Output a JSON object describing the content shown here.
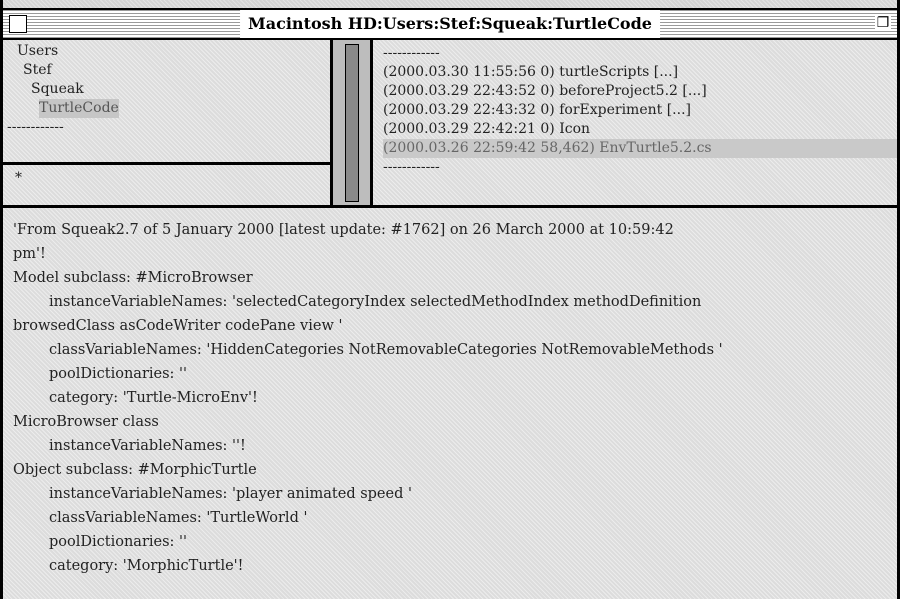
{
  "window": {
    "title": "Macintosh HD:Users:Stef:Squeak:TurtleCode"
  },
  "directory_list": {
    "items": [
      {
        "label": "Users"
      },
      {
        "label": "Stef"
      },
      {
        "label": "Squeak"
      },
      {
        "label": "TurtleCode",
        "selected": true
      },
      {
        "label": "------------"
      }
    ]
  },
  "pattern": {
    "value": "*"
  },
  "file_list": {
    "items": [
      {
        "label": "------------"
      },
      {
        "label": "(2000.03.30 11:55:56 0) turtleScripts [...]"
      },
      {
        "label": "(2000.03.29 22:43:52 0) beforeProject5.2 [...]"
      },
      {
        "label": "(2000.03.29 22:43:32 0) forExperiment [...]"
      },
      {
        "label": "(2000.03.29 22:42:21 0) Icon"
      },
      {
        "label": "(2000.03.26 22:59:42 58,462) EnvTurtle5.2.cs",
        "selected": true
      },
      {
        "label": "------------"
      }
    ]
  },
  "code": {
    "lines": [
      "'From Squeak2.7 of 5 January 2000 [latest update: #1762] on 26 March 2000 at 10:59:42",
      "pm'!",
      "Model subclass: #MicroBrowser",
      "instanceVariableNames: 'selectedCategoryIndex selectedMethodIndex methodDefinition",
      "browsedClass asCodeWriter codePane view '",
      "classVariableNames: 'HiddenCategories NotRemovableCategories NotRemovableMethods '",
      "poolDictionaries: ''",
      "category: 'Turtle-MicroEnv'!",
      "MicroBrowser class",
      "instanceVariableNames: ''!",
      "Object subclass: #MorphicTurtle",
      "instanceVariableNames: 'player animated speed '",
      "classVariableNames: 'TurtleWorld '",
      "poolDictionaries: ''",
      "category: 'MorphicTurtle'!"
    ]
  }
}
